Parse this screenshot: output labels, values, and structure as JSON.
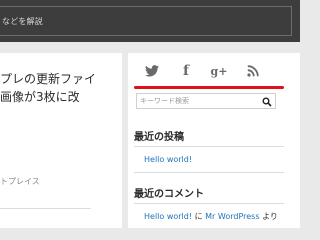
{
  "header": {
    "tagline": "などを解説"
  },
  "content": {
    "post_title_lines": [
      "プレの更新ファイ",
      "画像が3枚に改"
    ],
    "post_meta": "トプレイス"
  },
  "sidebar": {
    "social_icons": [
      "twitter-icon",
      "facebook-icon",
      "google-plus-icon",
      "rss-icon"
    ],
    "google_plus_text": "g+",
    "facebook_text": "f",
    "accent_color": "#e0101d",
    "search": {
      "placeholder": "キーワード検索"
    },
    "recent_posts": {
      "title": "最近の投稿",
      "items": [
        "Hello world!"
      ]
    },
    "recent_comments": {
      "title": "最近のコメント",
      "items": [
        {
          "post": "Hello world!",
          "connector": "に",
          "author": "Mr WordPress",
          "suffix": "より"
        }
      ]
    }
  }
}
